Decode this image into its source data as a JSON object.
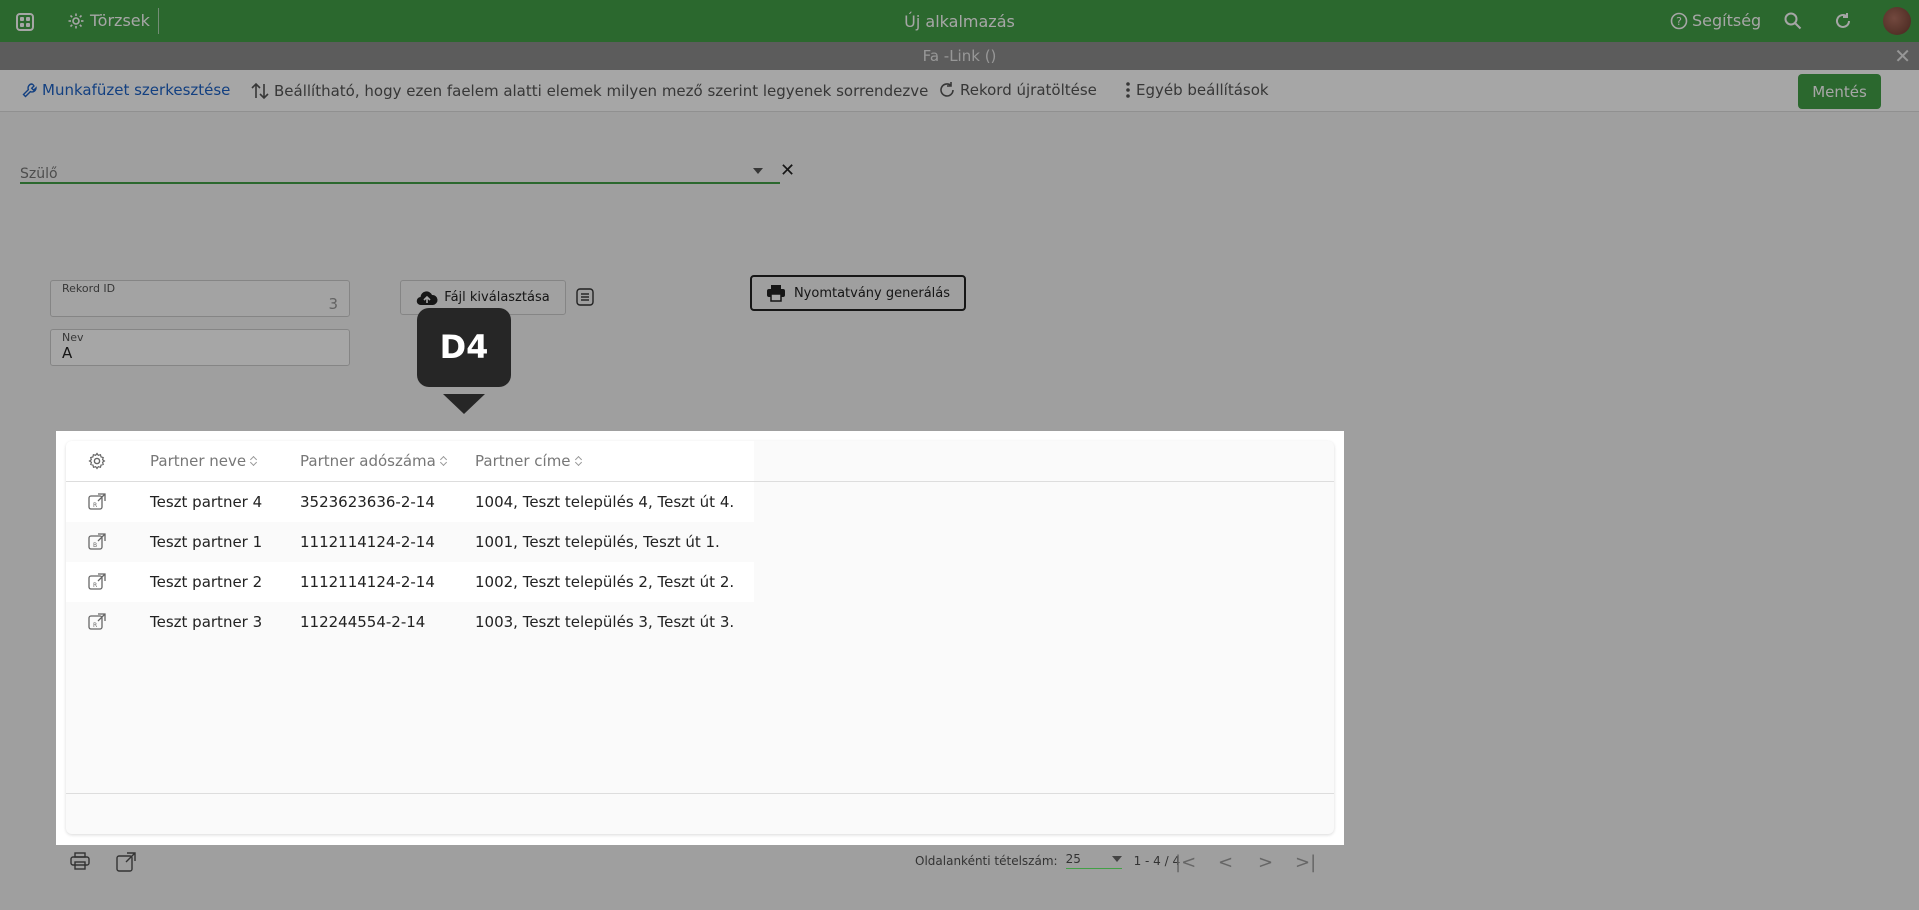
{
  "topbar": {
    "apps_icon": "apps-grid-icon",
    "torzsek_label": "Törzsek",
    "app_title": "Új alkalmazás",
    "help_label": "Segítség",
    "brand_color": "#43a047"
  },
  "window": {
    "title": "Fa -Link ()"
  },
  "toolbar": {
    "edit_workbook_label": "Munkafüzet szerkesztése",
    "sort_label": "Beállítható, hogy ezen faelem alatti elemek milyen mező szerint legyenek sorrendezve",
    "reload_label": "Rekord újratöltése",
    "other_settings_label": "Egyéb beállítások",
    "save_label": "Mentés"
  },
  "form": {
    "parent_label": "Szülő",
    "record_id_caption": "Rekord ID",
    "record_id_value": "3",
    "name_caption": "Nev",
    "name_value": "A",
    "file_button_label": "Fájl kiválasztása",
    "print_gen_label": "Nyomtatvány generálás"
  },
  "callout": {
    "label": "D4"
  },
  "table": {
    "columns": [
      "Partner neve",
      "Partner adószáma",
      "Partner címe"
    ],
    "rows": [
      [
        "Teszt partner 4",
        "3523623636-2-14",
        "1004, Teszt település 4, Teszt út 4."
      ],
      [
        "Teszt partner 1",
        "1112114124-2-14",
        "1001, Teszt település, Teszt út 1."
      ],
      [
        "Teszt partner 2",
        "1112114124-2-14",
        "1002, Teszt település 2, Teszt út 2."
      ],
      [
        "Teszt partner 3",
        "112244554-2-14",
        "1003, Teszt település 3, Teszt út 3."
      ]
    ]
  },
  "pager": {
    "per_page_label": "Oldalankénti tételszám:",
    "per_page_value": "25",
    "range": "1 - 4 / 4"
  }
}
